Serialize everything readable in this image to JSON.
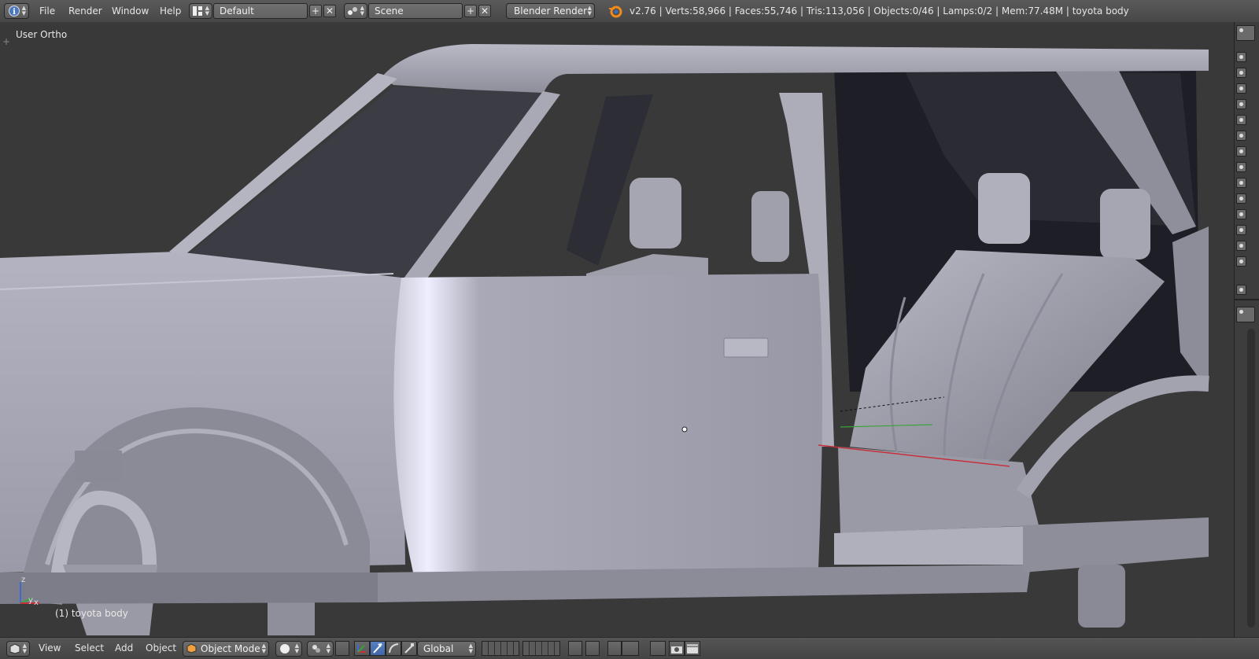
{
  "header": {
    "menu": [
      "File",
      "Render",
      "Window",
      "Help"
    ],
    "layout_name": "Default",
    "scene_name": "Scene",
    "render_engine": "Blender Render",
    "stats": "v2.76 | Verts:58,966 | Faces:55,746 | Tris:113,056 | Objects:0/46 | Lamps:0/2 | Mem:77.48M | toyota body"
  },
  "viewport": {
    "view_label": "User Ortho",
    "object_label": "(1) toyota body",
    "axis_labels": {
      "z": "z",
      "y": "y",
      "x": "x"
    },
    "background_color": "#393939",
    "mesh_color": "#a7a7b3"
  },
  "footer": {
    "menu": [
      "View",
      "Select",
      "Add",
      "Object"
    ],
    "mode": "Object Mode",
    "orientation": "Global"
  },
  "icons": {
    "info_editor": "info-icon",
    "blender_logo": "blender-logo-icon",
    "editor_type_3d": "cube-icon",
    "mode": "object-mode-cube-icon",
    "shading": "solid-sphere-icon",
    "pivot": "pivot-icon",
    "manipulator": "manipulator-icon",
    "translate": "translate-arrow-icon",
    "rotate": "rotate-arc-icon",
    "scale": "scale-icon",
    "render": "camera-icon",
    "render_anim": "clapperboard-icon"
  }
}
